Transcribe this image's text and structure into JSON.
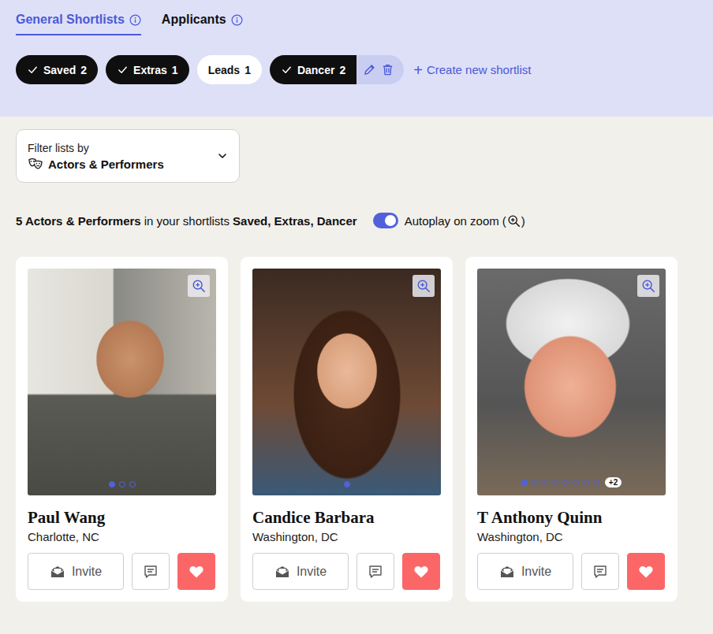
{
  "tabs": [
    {
      "label": "General Shortlists",
      "selected": true
    },
    {
      "label": "Applicants",
      "selected": false
    }
  ],
  "shortlists": [
    {
      "label": "Saved",
      "count": "2",
      "selected": true,
      "editable": false
    },
    {
      "label": "Extras",
      "count": "1",
      "selected": true,
      "editable": false
    },
    {
      "label": "Leads",
      "count": "1",
      "selected": false,
      "editable": false
    },
    {
      "label": "Dancer",
      "count": "2",
      "selected": true,
      "editable": true
    }
  ],
  "create_shortlist": {
    "icon": "+",
    "label": "Create new shortlist"
  },
  "filter": {
    "label": "Filter lists by",
    "value": "Actors & Performers"
  },
  "summary": {
    "count_category": "5 Actors & Performers",
    "middle": "in your shortlists",
    "lists": "Saved, Extras, Dancer"
  },
  "autoplay": {
    "label": "Autoplay on zoom",
    "open": "(",
    "close": ")",
    "on": true
  },
  "cards": [
    {
      "name": "Paul Wang",
      "location": "Charlotte, NC",
      "photos": [
        {
          "selected": true
        },
        {
          "selected": false
        },
        {
          "selected": false
        }
      ],
      "more": "",
      "invite": "Invite",
      "liked": true
    },
    {
      "name": "Candice Barbara",
      "location": "Washington, DC",
      "photos": [
        {
          "selected": true
        }
      ],
      "more": "",
      "invite": "Invite",
      "liked": true
    },
    {
      "name": "T Anthony Quinn",
      "location": "Washington, DC",
      "photos": [
        {
          "selected": true
        },
        {
          "selected": false
        },
        {
          "selected": false
        },
        {
          "selected": false
        },
        {
          "selected": false
        },
        {
          "selected": false
        },
        {
          "selected": false
        },
        {
          "selected": false
        }
      ],
      "more": "+2",
      "invite": "Invite",
      "liked": true
    }
  ]
}
